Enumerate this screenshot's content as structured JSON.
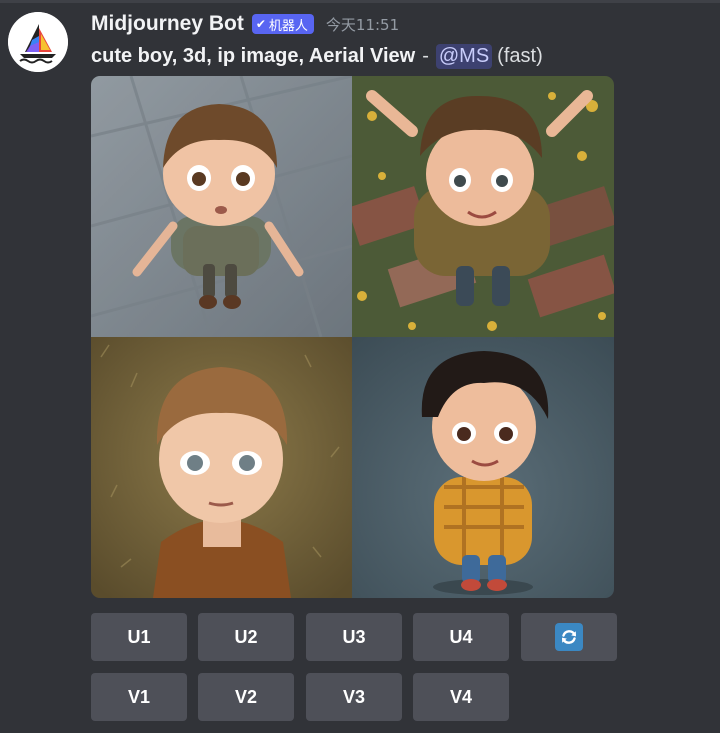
{
  "message": {
    "author": "Midjourney Bot",
    "badge_label": "机器人",
    "badge_icon": "check-icon",
    "timestamp": "今天11:51",
    "prompt_text": "cute boy, 3d, ip image, Aerial View",
    "separator": "-",
    "mention": "@MS",
    "speed": "(fast)"
  },
  "images": [
    {
      "subject": "boy-standing-on-stone-pavement"
    },
    {
      "subject": "boy-arms-raised-over-flower-field"
    },
    {
      "subject": "boy-looking-up-on-dry-grass"
    },
    {
      "subject": "boy-in-yellow-plaid-hoodie"
    }
  ],
  "buttons": {
    "upscale": [
      "U1",
      "U2",
      "U3",
      "U4"
    ],
    "variation": [
      "V1",
      "V2",
      "V3",
      "V4"
    ],
    "reroll_icon": "refresh-icon"
  },
  "colors": {
    "background": "#313338",
    "button": "#4e5058",
    "badge": "#5865f2",
    "mention_text": "#c9cdfb",
    "timestamp": "#949ba4"
  }
}
